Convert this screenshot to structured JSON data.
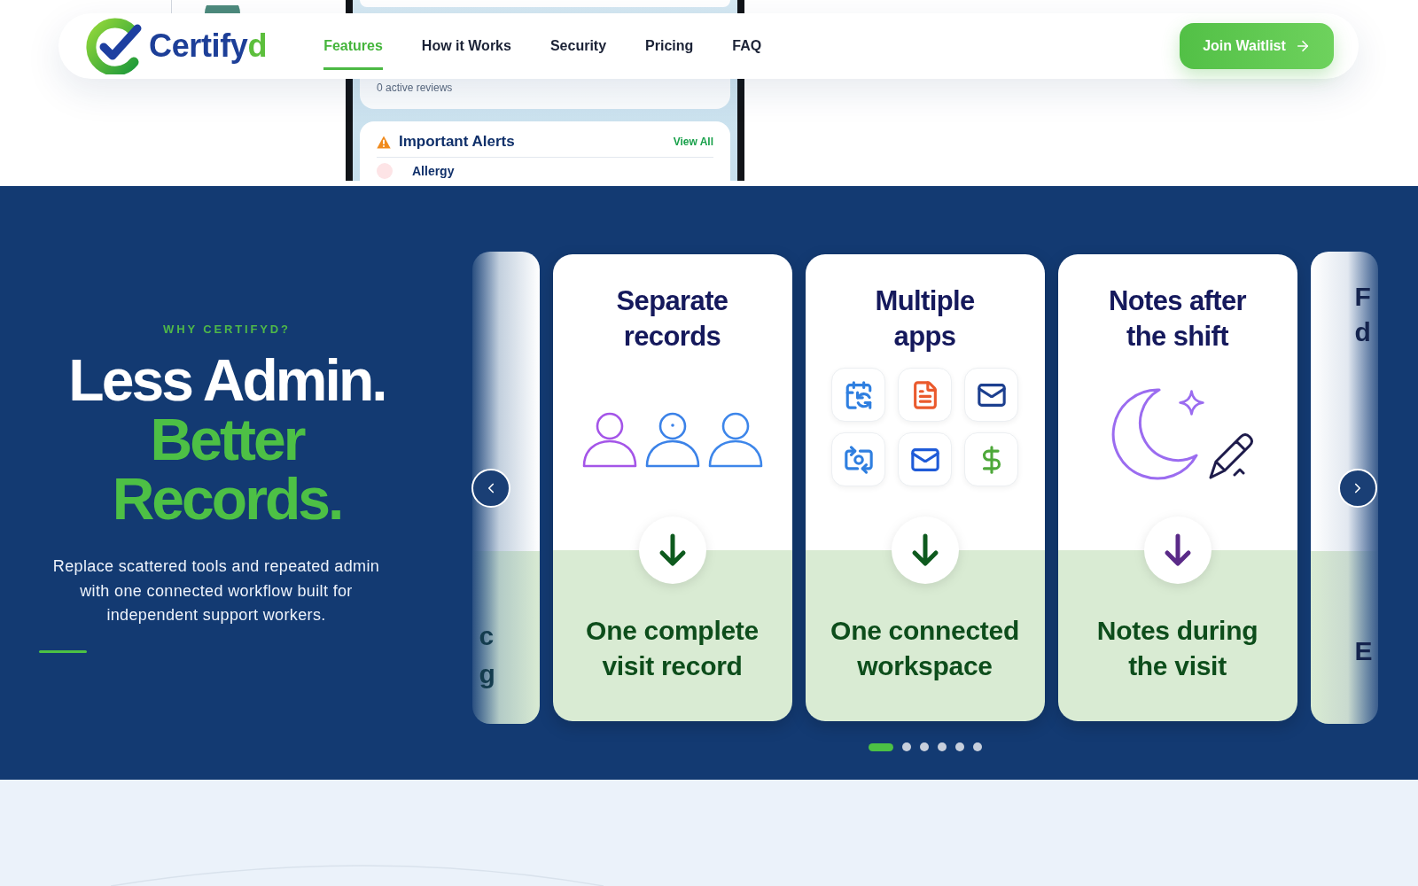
{
  "header": {
    "logo": {
      "text": "Certify",
      "accent": "d"
    },
    "nav": [
      {
        "label": "Features",
        "selected": true
      },
      {
        "label": "How it Works",
        "selected": false
      },
      {
        "label": "Security",
        "selected": false
      },
      {
        "label": "Pricing",
        "selected": false
      },
      {
        "label": "FAQ",
        "selected": false
      }
    ],
    "cta": "Join Waitlist"
  },
  "top_section": {
    "phone": {
      "reviews_caption": "0 active reviews",
      "alerts_title": "Important Alerts",
      "alerts_link": "View All",
      "alert_item": "Allergy"
    }
  },
  "hero": {
    "eyebrow": "WHY CERTIFYD?",
    "headline": "Less Admin.",
    "headline_accent": "Better Records.",
    "description": "Replace scattered tools and repeated admin with one connected workflow built for independent support workers."
  },
  "carousel": {
    "cards": [
      {
        "kind": "leftpeek",
        "result_fragments": [
          "c",
          "g"
        ]
      },
      {
        "kind": "records",
        "title": "Separate records",
        "result": "One complete visit record",
        "color": "#0e5a1e"
      },
      {
        "kind": "apps",
        "title": "Multiple apps",
        "result": "One connected workspace",
        "color": "#0e5a1e"
      },
      {
        "kind": "notes",
        "title": "Notes after the shift",
        "result": "Notes during the visit",
        "color": "#5a2a88"
      },
      {
        "kind": "rightpeek",
        "title_fragments": [
          "F",
          "d"
        ],
        "result_fragments": [
          "E"
        ]
      }
    ],
    "dots": [
      {
        "selected": true
      },
      {
        "selected": false
      },
      {
        "selected": false
      },
      {
        "selected": false
      },
      {
        "selected": false
      },
      {
        "selected": false
      }
    ]
  }
}
